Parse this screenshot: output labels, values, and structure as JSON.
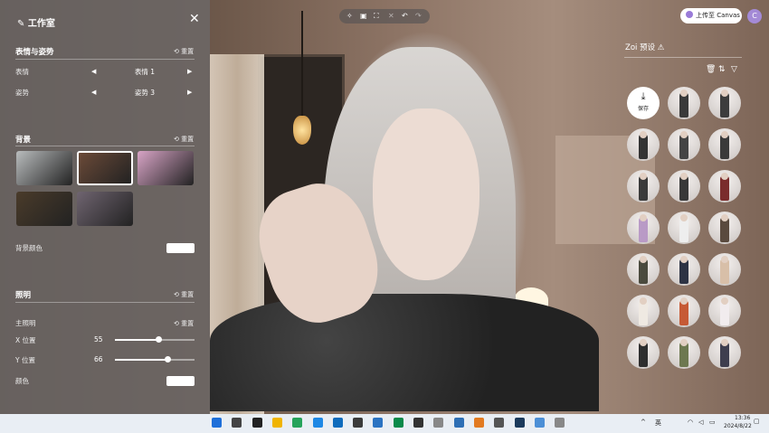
{
  "studio": {
    "title": "工作室",
    "sections": {
      "expression_pose": {
        "title": "表情与姿势",
        "reset": "重置",
        "rows": [
          {
            "label": "表情",
            "value": "表情 1"
          },
          {
            "label": "姿势",
            "value": "姿势 3"
          }
        ]
      },
      "background": {
        "title": "背景",
        "reset": "重置",
        "color_label": "背景颜色",
        "color_value": "#ffffff",
        "thumbnails": [
          {
            "name": "grey-gradient",
            "color": "#b9bcbd",
            "selected": false
          },
          {
            "name": "warm-room",
            "color": "#6b4a38",
            "selected": true
          },
          {
            "name": "pink-sky",
            "color": "#d8a4c6",
            "selected": false
          },
          {
            "name": "night-city",
            "color": "#4a3b2a",
            "selected": false
          },
          {
            "name": "neon-street",
            "color": "#6f6470",
            "selected": false
          }
        ]
      },
      "lighting": {
        "title": "照明",
        "reset": "重置",
        "main_light": {
          "label": "主照明",
          "reset": "重置"
        },
        "x": {
          "label": "X 位置",
          "value": "55",
          "fraction": 0.55
        },
        "y": {
          "label": "Y 位置",
          "value": "66",
          "fraction": 0.66
        },
        "color_label": "颜色",
        "color_value": "#ffffff"
      }
    }
  },
  "toolbar": {
    "icons": [
      "sparkle-icon",
      "camera-icon",
      "frame-icon",
      "close-icon",
      "undo-icon",
      "redo-icon"
    ]
  },
  "top_right": {
    "upload_label": "上传至 Canvas",
    "avatar_letter": "C"
  },
  "presets": {
    "title": "Zoi 预设",
    "save_label": "保存",
    "items": [
      {
        "outfit": "#3a3a3a"
      },
      {
        "outfit": "#3d3d3d"
      },
      {
        "outfit": "#333333"
      },
      {
        "outfit": "#444444"
      },
      {
        "outfit": "#3a3a3a"
      },
      {
        "outfit": "#3a3a3a"
      },
      {
        "outfit": "#383838"
      },
      {
        "outfit": "#7a2c2c"
      },
      {
        "outfit": "#b99ac6"
      },
      {
        "outfit": "#eeeeee"
      },
      {
        "outfit": "#5a4a3e"
      },
      {
        "outfit": "#4a4a3e"
      },
      {
        "outfit": "#2d3344"
      },
      {
        "outfit": "#d8bfa8"
      },
      {
        "outfit": "#efe9e2"
      },
      {
        "outfit": "#c65a35"
      },
      {
        "outfit": "#f1ecee"
      },
      {
        "outfit": "#2e2e2e"
      },
      {
        "outfit": "#6d7850"
      },
      {
        "outfit": "#3e3e4e"
      }
    ]
  },
  "taskbar": {
    "apps": [
      "#1e6fd9",
      "#444444",
      "#222222",
      "#f0b400",
      "#26a35b",
      "#1e88e5",
      "#0f6cbd",
      "#3b3b3b",
      "#2b73c2",
      "#0a8a4a",
      "#333333",
      "#888888",
      "#2e6fb5",
      "#e27a20",
      "#555555",
      "#1b3a5c",
      "#4c8fd6",
      "#888888"
    ],
    "lang": "英",
    "time": "13:36",
    "date": "2024/8/22"
  }
}
